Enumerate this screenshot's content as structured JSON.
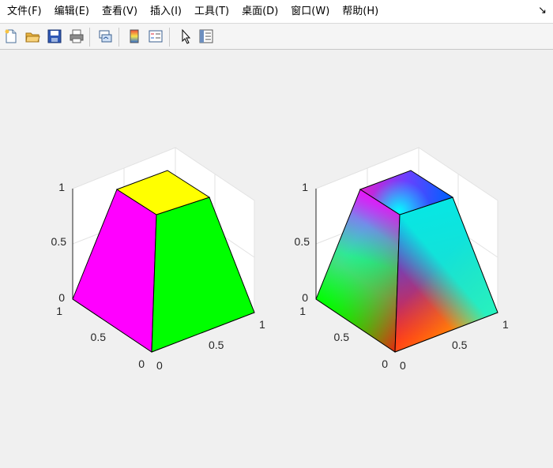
{
  "menubar": {
    "items": [
      {
        "id": "file",
        "label": "文件(F)"
      },
      {
        "id": "edit",
        "label": "编辑(E)"
      },
      {
        "id": "view",
        "label": "查看(V)"
      },
      {
        "id": "insert",
        "label": "插入(I)"
      },
      {
        "id": "tools",
        "label": "工具(T)"
      },
      {
        "id": "desktop",
        "label": "桌面(D)"
      },
      {
        "id": "window",
        "label": "窗口(W)"
      },
      {
        "id": "help",
        "label": "帮助(H)"
      }
    ],
    "dock_arrow": "↘"
  },
  "toolbar": {
    "buttons": [
      {
        "name": "new-figure-icon"
      },
      {
        "name": "open-file-icon"
      },
      {
        "name": "save-icon"
      },
      {
        "name": "print-icon"
      },
      {
        "name": "link-plot-icon"
      },
      {
        "name": "insert-colorbar-icon"
      },
      {
        "name": "insert-legend-icon"
      },
      {
        "name": "edit-plot-icon"
      },
      {
        "name": "property-inspector-icon"
      }
    ]
  },
  "axes": [
    {
      "id": "left",
      "z_ticks": [
        "0",
        "0.5",
        "1"
      ],
      "y_ticks": [
        "0",
        "0.5",
        "1"
      ],
      "x_ticks": [
        "0",
        "0.5",
        "1"
      ],
      "faces": {
        "top": "#ffff00",
        "left": "#ff00ff",
        "right": "#00ff00"
      }
    },
    {
      "id": "right",
      "z_ticks": [
        "0",
        "0.5",
        "1"
      ],
      "y_ticks": [
        "0",
        "0.5",
        "1"
      ],
      "x_ticks": [
        "0",
        "0.5",
        "1"
      ],
      "faces": {
        "top": "interpolated",
        "left": "interpolated",
        "right": "interpolated"
      }
    }
  ]
}
